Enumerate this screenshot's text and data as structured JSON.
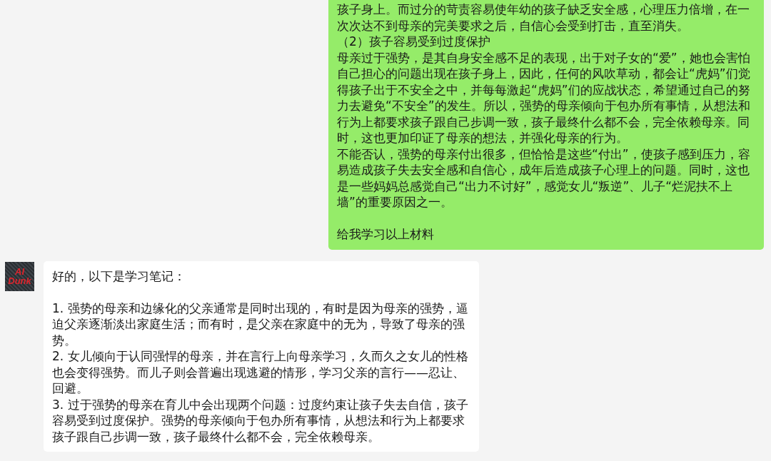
{
  "messages": [
    {
      "kind": "sent",
      "paragraphs": [
        {
          "text": "孩子身上。而过分的苛责容易使年幼的孩子缺乏安全感，心理压力倍增，在一次次达不到母亲的完美要求之后，自信心会受到打击，直至消失。",
          "spaced": false
        },
        {
          "text": "（2）孩子容易受到过度保护",
          "spaced": false
        },
        {
          "text": "母亲过于强势，是其自身安全感不足的表现，出于对子女的“爱”，她也会害怕自己担心的问题出现在孩子身上，因此，任何的风吹草动，都会让“虎妈”们觉得孩子出于不安全之中，并每每激起“虎妈”们的应战状态，希望通过自己的努力去避免“不安全”的发生。所以，强势的母亲倾向于包办所有事情，从想法和行为上都要求孩子跟自己步调一致，孩子最终什么都不会，完全依赖母亲。同时，这也更加印证了母亲的想法，并强化母亲的行为。",
          "spaced": false
        },
        {
          "text": "不能否认，强势的母亲付出很多，但恰恰是这些“付出”，使孩子感到压力，容易造成孩子失去安全感和自信心，成年后造成孩子心理上的问题。同时，这也是一些妈妈总感觉自己“出力不讨好”，感觉女儿“叛逆”、儿子“烂泥扶不上墙”的重要原因之一。",
          "spaced": false
        },
        {
          "text": "给我学习以上材料",
          "spaced": true
        }
      ]
    },
    {
      "kind": "received",
      "avatar": {
        "label": "AI Dunk"
      },
      "paragraphs": [
        {
          "text": "好的，以下是学习笔记：",
          "spaced": false
        },
        {
          "text": "1. 强势的母亲和边缘化的父亲通常是同时出现的，有时是因为母亲的强势，逼迫父亲逐渐淡出家庭生活；而有时，是父亲在家庭中的无为，导致了母亲的强势。",
          "spaced": true
        },
        {
          "text": "2. 女儿倾向于认同强悍的母亲，并在言行上向母亲学习，久而久之女儿的性格也会变得强势。而儿子则会普遍出现逃避的情形，学习父亲的言行——忍让、回避。",
          "spaced": false
        },
        {
          "text": "3. 过于强势的母亲在育儿中会出现两个问题：过度约束让孩子失去自信，孩子容易受到过度保护。强势的母亲倾向于包办所有事情，从想法和行为上都要求孩子跟自己步调一致，孩子最终什么都不会，完全依赖母亲。",
          "spaced": false
        }
      ]
    }
  ]
}
